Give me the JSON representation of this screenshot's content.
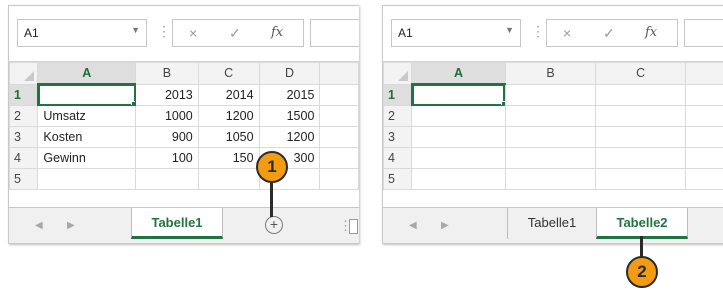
{
  "panels": [
    {
      "name_box": "A1",
      "columns": [
        "A",
        "B",
        "C",
        "D"
      ],
      "rows": [
        {
          "num": "1",
          "cells": [
            "",
            "2013",
            "2014",
            "2015"
          ]
        },
        {
          "num": "2",
          "cells": [
            "Umsatz",
            "1000",
            "1200",
            "1500"
          ]
        },
        {
          "num": "3",
          "cells": [
            "Kosten",
            "900",
            "1050",
            "1200"
          ]
        },
        {
          "num": "4",
          "cells": [
            "Gewinn",
            "100",
            "150",
            "300"
          ]
        },
        {
          "num": "5",
          "cells": [
            "",
            "",
            "",
            ""
          ]
        }
      ],
      "tabs": [
        "Tabelle1"
      ],
      "active_tab": "Tabelle1",
      "add_sheet_icon": "plus-circle-icon"
    },
    {
      "name_box": "A1",
      "columns": [
        "A",
        "B",
        "C"
      ],
      "rows": [
        {
          "num": "1",
          "cells": [
            "",
            "",
            ""
          ]
        },
        {
          "num": "2",
          "cells": [
            "",
            "",
            ""
          ]
        },
        {
          "num": "3",
          "cells": [
            "",
            "",
            ""
          ]
        },
        {
          "num": "4",
          "cells": [
            "",
            "",
            ""
          ]
        },
        {
          "num": "5",
          "cells": [
            "",
            "",
            ""
          ]
        }
      ],
      "tabs": [
        "Tabelle1",
        "Tabelle2"
      ],
      "active_tab": "Tabelle2"
    }
  ],
  "formula_bar": {
    "cancel_icon": "×",
    "enter_icon": "✓",
    "fx_label": "fx"
  },
  "callouts": [
    "1",
    "2"
  ],
  "colors": {
    "accent": "#217346",
    "callout": "#f39c12"
  }
}
